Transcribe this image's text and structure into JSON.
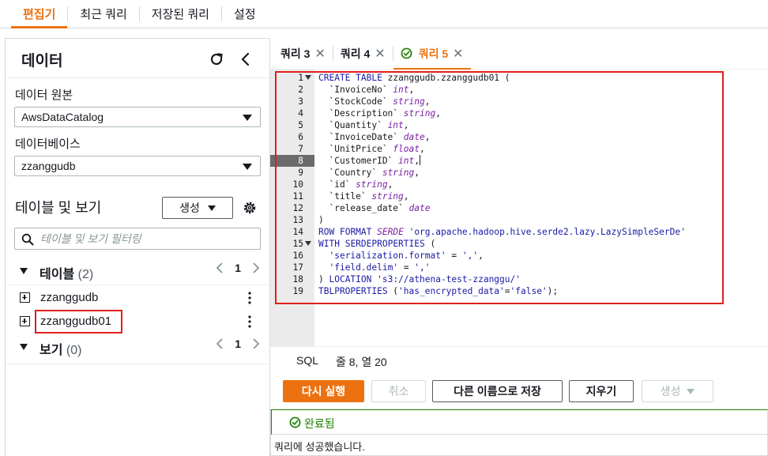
{
  "top_tabs": [
    {
      "label": "편집기",
      "active": true
    },
    {
      "label": "최근 쿼리",
      "active": false
    },
    {
      "label": "저장된 쿼리",
      "active": false
    },
    {
      "label": "설정",
      "active": false
    }
  ],
  "left_panel": {
    "title": "데이터",
    "data_source_label": "데이터 원본",
    "data_source_value": "AwsDataCatalog",
    "database_label": "데이터베이스",
    "database_value": "zzanggudb",
    "tables_views_title": "테이블 및 보기",
    "create_label": "생성",
    "filter_placeholder": "테이블 및 보기 필터링",
    "tables": {
      "name": "테이블",
      "count": "(2)",
      "page": "1",
      "items": [
        "zzanggudb",
        "zzanggudb01"
      ]
    },
    "views": {
      "name": "보기",
      "count": "(0)",
      "page": "1"
    }
  },
  "editor_tabs": [
    {
      "label": "쿼리 3",
      "active": false
    },
    {
      "label": "쿼리 4",
      "active": false
    },
    {
      "label": "쿼리 5",
      "active": true
    }
  ],
  "editor": {
    "active_line": 8,
    "lines": [
      "CREATE TABLE zzanggudb.zzanggudb01 (",
      "  `InvoiceNo` int,",
      "  `StockCode` string,",
      "  `Description` string,",
      "  `Quantity` int,",
      "  `InvoiceDate` date,",
      "  `UnitPrice` float,",
      "  `CustomerID` int,",
      "  `Country` string,",
      "  `id` string,",
      "  `title` string,",
      "  `release_date` date",
      ")",
      "ROW FORMAT SERDE 'org.apache.hadoop.hive.serde2.lazy.LazySimpleSerDe'",
      "WITH SERDEPROPERTIES (",
      "  'serialization.format' = ',',",
      "  'field.delim' = ','",
      ") LOCATION 's3://athena-test-zzanggu/'",
      "TBLPROPERTIES ('has_encrypted_data'='false');"
    ]
  },
  "status": {
    "language": "SQL",
    "position": "줄 8, 열 20"
  },
  "buttons": {
    "run_again": "다시 실행",
    "cancel": "취소",
    "save_as": "다른 이름으로 저장",
    "clear": "지우기",
    "create": "생성"
  },
  "result": {
    "status": "완료됨",
    "message": "쿼리에 성공했습니다."
  },
  "colors": {
    "accent": "#ec7211",
    "success": "#1d8102",
    "highlight": "#e0201c"
  }
}
